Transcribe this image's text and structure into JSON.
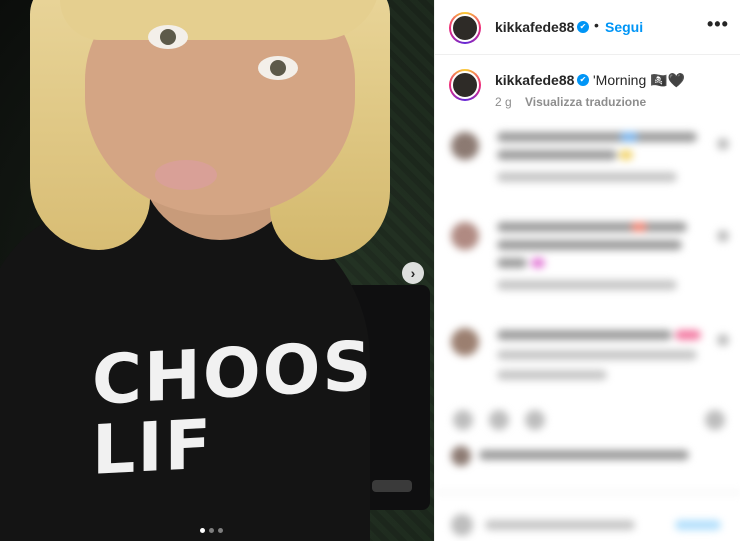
{
  "post": {
    "image_alt": "selfie",
    "shirt_text_line1": "CHOOS",
    "shirt_text_line2": "LIF",
    "next_icon": "›",
    "carousel_dots": 3
  },
  "header": {
    "username": "kikkafede88",
    "verified_icon": "✔",
    "separator": "•",
    "follow_label": "Segui",
    "more_icon": "•••"
  },
  "caption": {
    "username": "kikkafede88",
    "verified_icon": "✔",
    "text": "'Morning 🏴‍☠️🖤",
    "time": "2 g",
    "translate_label": "Visualizza traduzione"
  },
  "colors": {
    "accent": "#0095f6",
    "text": "#262626",
    "muted": "#8e8e8e"
  }
}
